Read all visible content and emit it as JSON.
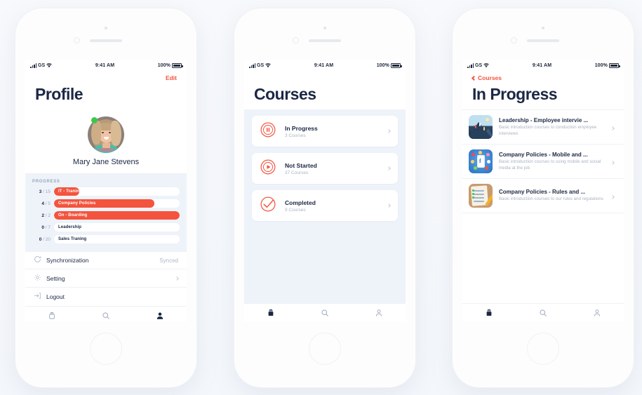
{
  "status_bar": {
    "carrier": "GS",
    "time": "9:41 AM",
    "battery": "100%"
  },
  "phone1": {
    "nav": {
      "edit_label": "Edit",
      "title": "Profile"
    },
    "profile": {
      "name": "Mary Jane Stevens",
      "online": true
    },
    "progress": {
      "section_label": "PROGRESS",
      "items": [
        {
          "label": "IT - Traning",
          "done": 3,
          "total": 15,
          "fraction": "3 / 15"
        },
        {
          "label": "Company Policies",
          "done": 4,
          "total": 5,
          "fraction": "4 / 5"
        },
        {
          "label": "On - Boarding",
          "done": 2,
          "total": 2,
          "fraction": "2 / 2"
        },
        {
          "label": "Leadership",
          "done": 0,
          "total": 7,
          "fraction": "0 / 7"
        },
        {
          "label": "Sales Traning",
          "done": 0,
          "total": 20,
          "fraction": "0 / 20"
        }
      ]
    },
    "menu": [
      {
        "icon": "sync-icon",
        "label": "Synchronization",
        "value": "Synced",
        "chevron": false
      },
      {
        "icon": "gear-icon",
        "label": "Setting",
        "value": "",
        "chevron": true
      },
      {
        "icon": "logout-icon",
        "label": "Logout",
        "value": "",
        "chevron": false
      }
    ],
    "tabs": [
      {
        "icon": "courses-icon",
        "active": false
      },
      {
        "icon": "search-icon",
        "active": false
      },
      {
        "icon": "profile-icon",
        "active": true
      }
    ]
  },
  "phone2": {
    "nav": {
      "title": "Courses"
    },
    "cards": [
      {
        "icon": "pause-circle-icon",
        "title": "In Progress",
        "subtitle": "3 Courses"
      },
      {
        "icon": "play-circle-icon",
        "title": "Not Started",
        "subtitle": "37 Courses"
      },
      {
        "icon": "check-circle-icon",
        "title": "Completed",
        "subtitle": "9 Courses"
      }
    ],
    "tabs": [
      {
        "icon": "courses-icon",
        "active": true
      },
      {
        "icon": "search-icon",
        "active": false
      },
      {
        "icon": "profile-icon",
        "active": false
      }
    ]
  },
  "phone3": {
    "nav": {
      "back_label": "Courses",
      "title": "In Progress"
    },
    "items": [
      {
        "thumb": "mountain-climbers-thumb",
        "title": "Leadership - Employee intervie ...",
        "desc": "Basic introduction courses to conduction employee interviews"
      },
      {
        "thumb": "social-media-thumb",
        "title": "Company Policies - Mobile and ...",
        "desc": "Basic introduction courses to using mobile and social media at the job"
      },
      {
        "thumb": "checklist-thumb",
        "title": "Company Policies - Rules and ...",
        "desc": "Basic introduction courses to our rules and regulations"
      }
    ],
    "tabs": [
      {
        "icon": "courses-icon",
        "active": true
      },
      {
        "icon": "search-icon",
        "active": false
      },
      {
        "icon": "profile-icon",
        "active": false
      }
    ]
  },
  "colors": {
    "accent_red": "#f4533d",
    "navy": "#1b2744",
    "muted": "#a9b3c3",
    "panel_blue": "#eef3fa",
    "online_green": "#3cc84a"
  }
}
